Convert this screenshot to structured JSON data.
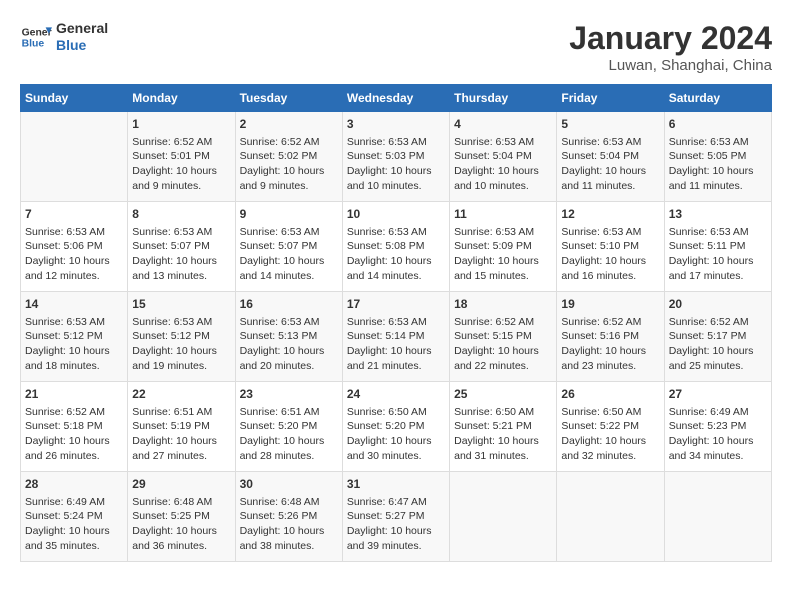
{
  "header": {
    "logo_general": "General",
    "logo_blue": "Blue",
    "month_title": "January 2024",
    "location": "Luwan, Shanghai, China"
  },
  "days_of_week": [
    "Sunday",
    "Monday",
    "Tuesday",
    "Wednesday",
    "Thursday",
    "Friday",
    "Saturday"
  ],
  "weeks": [
    [
      {
        "day": "",
        "info": ""
      },
      {
        "day": "1",
        "info": "Sunrise: 6:52 AM\nSunset: 5:01 PM\nDaylight: 10 hours\nand 9 minutes."
      },
      {
        "day": "2",
        "info": "Sunrise: 6:52 AM\nSunset: 5:02 PM\nDaylight: 10 hours\nand 9 minutes."
      },
      {
        "day": "3",
        "info": "Sunrise: 6:53 AM\nSunset: 5:03 PM\nDaylight: 10 hours\nand 10 minutes."
      },
      {
        "day": "4",
        "info": "Sunrise: 6:53 AM\nSunset: 5:04 PM\nDaylight: 10 hours\nand 10 minutes."
      },
      {
        "day": "5",
        "info": "Sunrise: 6:53 AM\nSunset: 5:04 PM\nDaylight: 10 hours\nand 11 minutes."
      },
      {
        "day": "6",
        "info": "Sunrise: 6:53 AM\nSunset: 5:05 PM\nDaylight: 10 hours\nand 11 minutes."
      }
    ],
    [
      {
        "day": "7",
        "info": "Sunrise: 6:53 AM\nSunset: 5:06 PM\nDaylight: 10 hours\nand 12 minutes."
      },
      {
        "day": "8",
        "info": "Sunrise: 6:53 AM\nSunset: 5:07 PM\nDaylight: 10 hours\nand 13 minutes."
      },
      {
        "day": "9",
        "info": "Sunrise: 6:53 AM\nSunset: 5:07 PM\nDaylight: 10 hours\nand 14 minutes."
      },
      {
        "day": "10",
        "info": "Sunrise: 6:53 AM\nSunset: 5:08 PM\nDaylight: 10 hours\nand 14 minutes."
      },
      {
        "day": "11",
        "info": "Sunrise: 6:53 AM\nSunset: 5:09 PM\nDaylight: 10 hours\nand 15 minutes."
      },
      {
        "day": "12",
        "info": "Sunrise: 6:53 AM\nSunset: 5:10 PM\nDaylight: 10 hours\nand 16 minutes."
      },
      {
        "day": "13",
        "info": "Sunrise: 6:53 AM\nSunset: 5:11 PM\nDaylight: 10 hours\nand 17 minutes."
      }
    ],
    [
      {
        "day": "14",
        "info": "Sunrise: 6:53 AM\nSunset: 5:12 PM\nDaylight: 10 hours\nand 18 minutes."
      },
      {
        "day": "15",
        "info": "Sunrise: 6:53 AM\nSunset: 5:12 PM\nDaylight: 10 hours\nand 19 minutes."
      },
      {
        "day": "16",
        "info": "Sunrise: 6:53 AM\nSunset: 5:13 PM\nDaylight: 10 hours\nand 20 minutes."
      },
      {
        "day": "17",
        "info": "Sunrise: 6:53 AM\nSunset: 5:14 PM\nDaylight: 10 hours\nand 21 minutes."
      },
      {
        "day": "18",
        "info": "Sunrise: 6:52 AM\nSunset: 5:15 PM\nDaylight: 10 hours\nand 22 minutes."
      },
      {
        "day": "19",
        "info": "Sunrise: 6:52 AM\nSunset: 5:16 PM\nDaylight: 10 hours\nand 23 minutes."
      },
      {
        "day": "20",
        "info": "Sunrise: 6:52 AM\nSunset: 5:17 PM\nDaylight: 10 hours\nand 25 minutes."
      }
    ],
    [
      {
        "day": "21",
        "info": "Sunrise: 6:52 AM\nSunset: 5:18 PM\nDaylight: 10 hours\nand 26 minutes."
      },
      {
        "day": "22",
        "info": "Sunrise: 6:51 AM\nSunset: 5:19 PM\nDaylight: 10 hours\nand 27 minutes."
      },
      {
        "day": "23",
        "info": "Sunrise: 6:51 AM\nSunset: 5:20 PM\nDaylight: 10 hours\nand 28 minutes."
      },
      {
        "day": "24",
        "info": "Sunrise: 6:50 AM\nSunset: 5:20 PM\nDaylight: 10 hours\nand 30 minutes."
      },
      {
        "day": "25",
        "info": "Sunrise: 6:50 AM\nSunset: 5:21 PM\nDaylight: 10 hours\nand 31 minutes."
      },
      {
        "day": "26",
        "info": "Sunrise: 6:50 AM\nSunset: 5:22 PM\nDaylight: 10 hours\nand 32 minutes."
      },
      {
        "day": "27",
        "info": "Sunrise: 6:49 AM\nSunset: 5:23 PM\nDaylight: 10 hours\nand 34 minutes."
      }
    ],
    [
      {
        "day": "28",
        "info": "Sunrise: 6:49 AM\nSunset: 5:24 PM\nDaylight: 10 hours\nand 35 minutes."
      },
      {
        "day": "29",
        "info": "Sunrise: 6:48 AM\nSunset: 5:25 PM\nDaylight: 10 hours\nand 36 minutes."
      },
      {
        "day": "30",
        "info": "Sunrise: 6:48 AM\nSunset: 5:26 PM\nDaylight: 10 hours\nand 38 minutes."
      },
      {
        "day": "31",
        "info": "Sunrise: 6:47 AM\nSunset: 5:27 PM\nDaylight: 10 hours\nand 39 minutes."
      },
      {
        "day": "",
        "info": ""
      },
      {
        "day": "",
        "info": ""
      },
      {
        "day": "",
        "info": ""
      }
    ]
  ]
}
